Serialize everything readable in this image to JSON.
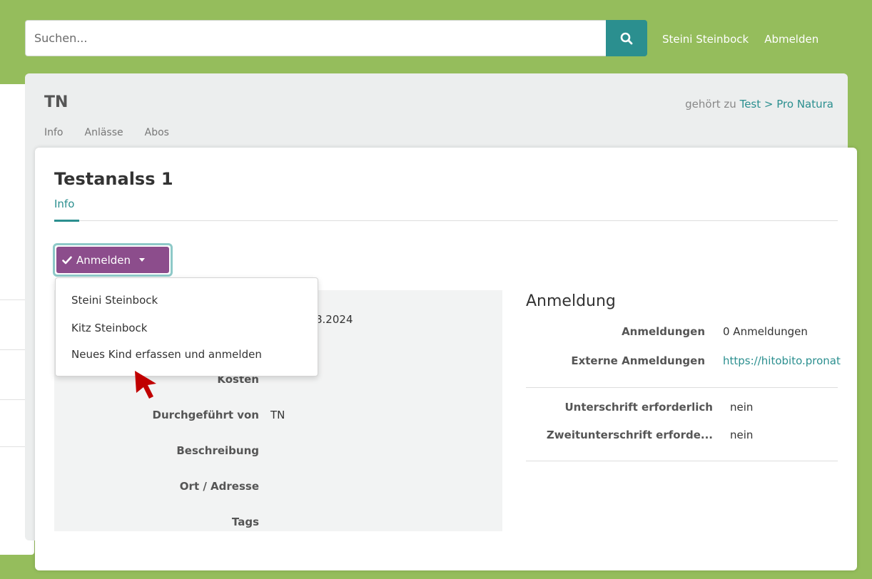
{
  "search": {
    "placeholder": "Suchen..."
  },
  "header": {
    "user_name": "Steini Steinbock",
    "logout_label": "Abmelden"
  },
  "group": {
    "title": "TN",
    "tabs": [
      "Info",
      "Anlässe",
      "Abos"
    ],
    "belongs_prefix": "gehört zu",
    "belongs_path": [
      "Test",
      "Pro Natura"
    ],
    "belongs_sep": ">"
  },
  "event": {
    "title": "Testanalss 1",
    "tab": "Info",
    "register_button": "Anmelden",
    "dropdown": [
      "Steini Steinbock",
      "Kitz Steinbock",
      "Neues Kind erfassen und anmelden"
    ],
    "info": [
      {
        "label": "",
        "value": "8.2024"
      },
      {
        "label": "Kosten",
        "value": ""
      },
      {
        "label": "Durchgeführt von",
        "value": "TN"
      },
      {
        "label": "Beschreibung",
        "value": ""
      },
      {
        "label": "Ort / Adresse",
        "value": ""
      },
      {
        "label": "Tags",
        "value": ""
      }
    ],
    "registration": {
      "title": "Anmeldung",
      "rows": [
        {
          "label": "Anmeldungen",
          "value": "0 Anmeldungen"
        },
        {
          "label": "Externe Anmeldungen",
          "value": "https://hitobito.pronat"
        }
      ],
      "rows2": [
        {
          "label": "Unterschrift erforderlich",
          "value": "nein"
        },
        {
          "label": "Zweitunterschrift erforde...",
          "value": "nein"
        }
      ]
    }
  },
  "colors": {
    "background": "#95bd5c",
    "accent": "#2b8f8f",
    "button": "#8c4d8c"
  }
}
